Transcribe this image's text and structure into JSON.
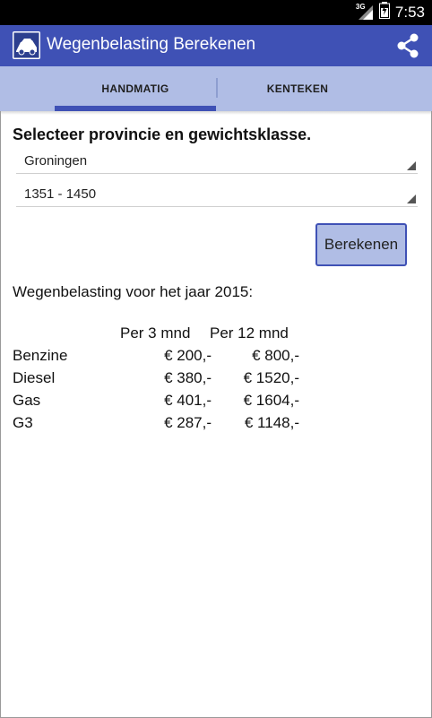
{
  "status_bar": {
    "time": "7:53",
    "network_label": "3G"
  },
  "app_bar": {
    "title": "Wegenbelasting Berekenen",
    "icons": {
      "logo": "car-logo-icon",
      "share": "share-icon"
    }
  },
  "tabs": [
    {
      "label": "HANDMATIG",
      "selected": true
    },
    {
      "label": "KENTEKEN",
      "selected": false
    }
  ],
  "form": {
    "heading": "Selecteer provincie en gewichtsklasse.",
    "province": "Groningen",
    "weight_class": "1351 - 1450",
    "button_label": "Berekenen"
  },
  "result": {
    "title": "Wegenbelasting voor het jaar 2015:",
    "col_headers": [
      "Per 3 mnd",
      "Per 12 mnd"
    ],
    "rows": [
      {
        "label": "Benzine",
        "per3": "€ 200,-",
        "per12": "€ 800,-"
      },
      {
        "label": "Diesel",
        "per3": "€ 380,-",
        "per12": "€ 1520,-"
      },
      {
        "label": "Gas",
        "per3": "€ 401,-",
        "per12": "€ 1604,-"
      },
      {
        "label": "G3",
        "per3": "€ 287,-",
        "per12": "€ 1148,-"
      }
    ]
  },
  "colors": {
    "primary": "#3f51b5",
    "tab_bar": "#b0bde5",
    "status_bar": "#000000"
  }
}
